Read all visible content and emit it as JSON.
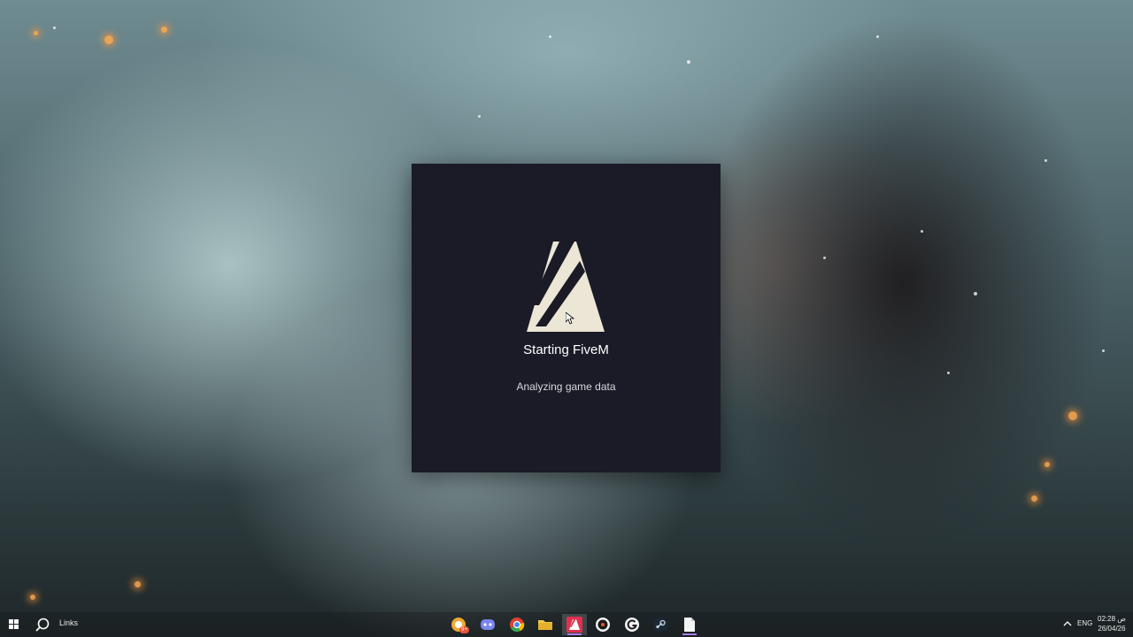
{
  "splash": {
    "title": "Starting FiveM",
    "status": "Analyzing game data"
  },
  "taskbar": {
    "search_label": "Links",
    "apps": [
      {
        "name": "opera-gx",
        "badge": "9+"
      },
      {
        "name": "discord"
      },
      {
        "name": "chrome"
      },
      {
        "name": "file-explorer"
      },
      {
        "name": "fivem",
        "active": true
      },
      {
        "name": "rockstar-launcher"
      },
      {
        "name": "logitech-g-hub"
      },
      {
        "name": "steam"
      },
      {
        "name": "notepad"
      }
    ],
    "tray": {
      "language": "ENG",
      "time": "02:28 ص",
      "date": "26/04/26"
    }
  },
  "colors": {
    "splash_bg": "#1a1b26",
    "logo": "#ece6d6",
    "active_indicator": "#a880e0"
  }
}
